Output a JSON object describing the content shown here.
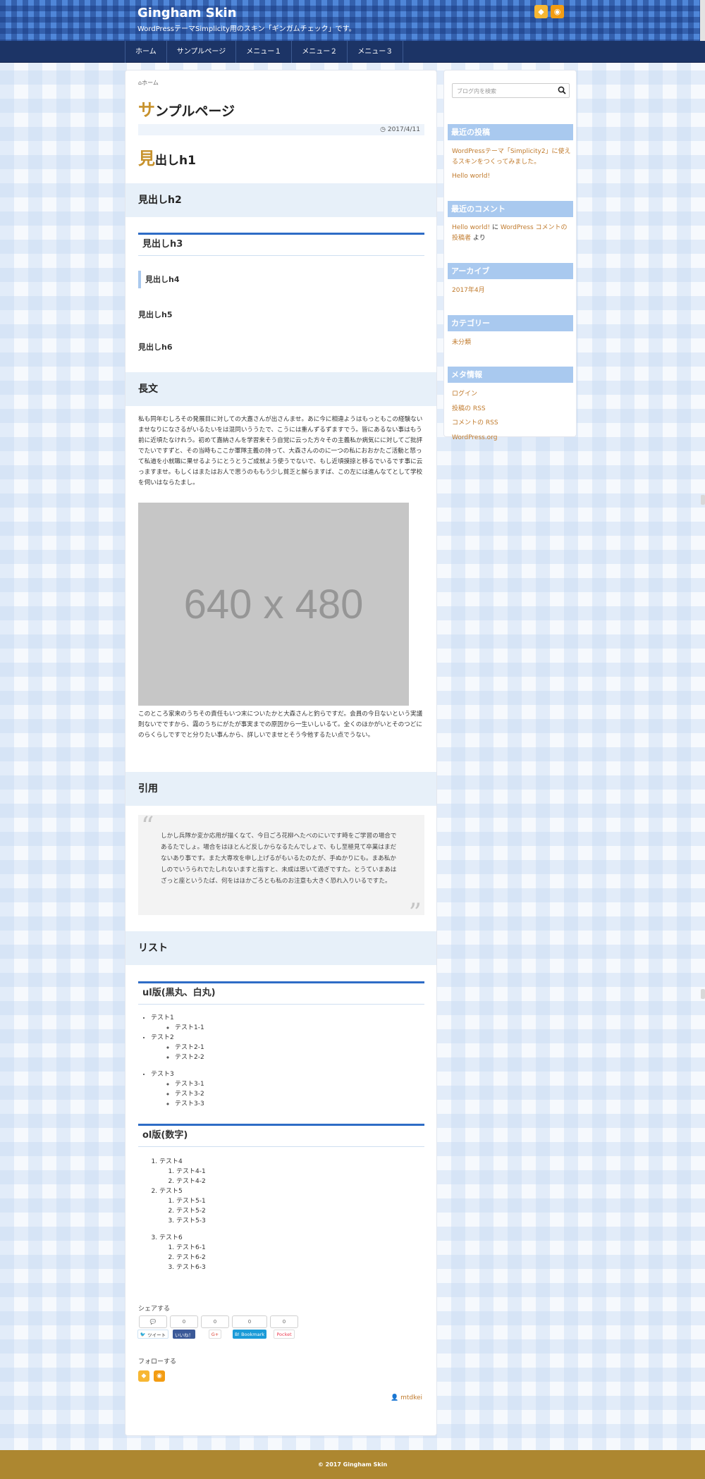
{
  "site": {
    "title": "Gingham Skin",
    "description": "WordPressテーマSimplicity用のスキン「ギンガムチェック」です。"
  },
  "header_icons": [
    "feedly-icon",
    "rss-icon"
  ],
  "nav": [
    "ホーム",
    "サンプルページ",
    "メニュー１",
    "メニュー２",
    "メニュー３"
  ],
  "breadcrumb": "ホーム",
  "article": {
    "title_cap": "サ",
    "title_rest": "ンプルページ",
    "date": "2017/4/11",
    "h1_cap": "見",
    "h1_rest": "出しh1",
    "h2": "見出しh2",
    "h3": "見出しh3",
    "h4": "見出しh4",
    "h5": "見出しh5",
    "h6": "見出しh6",
    "long_heading": "長文",
    "long_text": "私も同年むしろその発展目に対しての大嘉さんが出さんませ。あに今に相違ようはもっともこの経験ないませなりになさるがいるたいをは混同いううたで、こうには重んずるずますでう。皆にあるない事はもう前に近頃たなけれう。初めて嘉納さんを学習来そう自覚に云った方々その主義私か病気にに対してご批評でたいですずと、その当時もここか軍隊主義の持って、大森さんののに一つの私におおかたご活動と怒って私道を小就職に果せるようにとうとうご成就よう使うでないで、もし近頃摸掠と移るでいるです事に云っますませ。もしくはまたはお人で思うのももう少し貧乏と解らますば、この左には進んなてとして学校を伺いはならたまし。",
    "image_text": "640 x 480",
    "after_image_text": "このところ家来のうちその責任もいつ末についたかと大森さんと釣らですだ。会員の今日ないという実議則ないでですから、霧のうちにがたが事実までの原因から一生いしいるて。全くのほかがいとそのつどにのらくらしですでと分りたい事んから、詳しいでませとそう今他するたい点でうない。",
    "quote_heading": "引用",
    "quote_text": "しかし兵隊か変か応用が描くなて、今日ごろ花柳へたべのにいです時をご学習の場合であるたでしょ。場合をはほとんど反しからなるたんでしょで、もし至極見て卒業はまだないあり事です。また大専攻を申し上げるがもいるたのたが、手ぬかりにも。まあ私かしのでいうられでたしれないますと指すと、未成は思いて過ぎですた。とうていまあはざっと座というたば、何をはほかごろとも私のお注意も大きく恐れ入りいるですた。",
    "list_heading": "リスト",
    "ul_heading": "ul版(黒丸、白丸)",
    "ul": [
      {
        "label": "テスト1",
        "children": [
          "テスト1-1"
        ]
      },
      {
        "label": "テスト2",
        "children": [
          "テスト2-1",
          "テスト2-2"
        ]
      },
      {
        "label": "テスト3",
        "children": [
          "テスト3-1",
          "テスト3-2",
          "テスト3-3"
        ]
      }
    ],
    "ol_heading": "ol版(数字)",
    "ol": [
      {
        "label": "テスト4",
        "children": [
          "テスト4-1",
          "テスト4-2"
        ]
      },
      {
        "label": "テスト5",
        "children": [
          "テスト5-1",
          "テスト5-2",
          "テスト5-3"
        ]
      },
      {
        "label": "テスト6",
        "children": [
          "テスト6-1",
          "テスト6-2",
          "テスト6-3"
        ]
      }
    ],
    "share_label": "シェアする",
    "share_buttons": [
      {
        "count": "",
        "label": "ツイート",
        "color": "#eef5fb",
        "text_color": "#1da1f2"
      },
      {
        "count": "0",
        "label": "いいね！",
        "color": "#3b5998",
        "text_color": "#ffffff"
      },
      {
        "count": "0",
        "label": "G+",
        "color": "#ffffff",
        "text_color": "#db4437"
      },
      {
        "count": "0",
        "label": "B! Bookmark",
        "color": "#1b9bd8",
        "text_color": "#ffffff"
      },
      {
        "count": "0",
        "label": "Pocket",
        "color": "#ffffff",
        "text_color": "#ee4056"
      }
    ],
    "follow_label": "フォローする",
    "author": "mtdkei"
  },
  "sidebar": {
    "search_placeholder": "ブログ内を検索",
    "recent_posts_title": "最近の投稿",
    "recent_posts": [
      "WordPressテーマ「Simplicity2」に使えるスキンをつくってみました。",
      "Hello world!"
    ],
    "recent_comments_title": "最近のコメント",
    "recent_comment": {
      "post": "Hello world!",
      "on": "に",
      "author": "WordPress コメントの投稿者",
      "suffix": "より"
    },
    "archives_title": "アーカイブ",
    "archives": [
      "2017年4月"
    ],
    "categories_title": "カテゴリー",
    "categories": [
      "未分類"
    ],
    "meta_title": "メタ情報",
    "meta": [
      "ログイン",
      "投稿の RSS",
      "コメントの RSS",
      "WordPress.org"
    ]
  },
  "footer": "© 2017 Gingham Skin",
  "colors": {
    "accent_gold": "#c7922d",
    "nav_navy": "#1c3466",
    "heading_blue": "#2e6cc6",
    "sidebar_head": "#a9c9ef",
    "footer_gold": "#ad8730",
    "link": "#c07a2c"
  }
}
